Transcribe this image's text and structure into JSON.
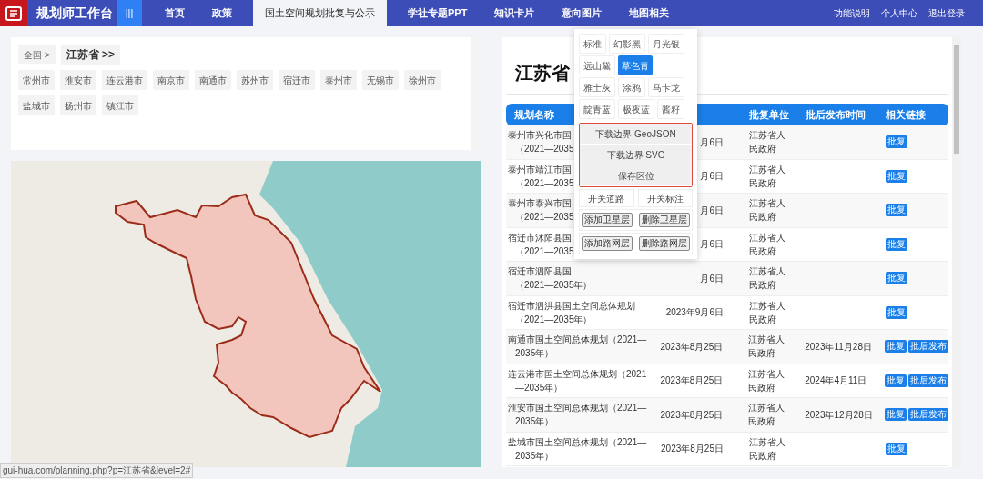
{
  "header": {
    "title": "规划师工作台",
    "menu_glyph": "|||",
    "nav": [
      {
        "label": "首页",
        "selected": false
      },
      {
        "label": "政策",
        "selected": false
      },
      {
        "label": "国土空间规划批复与公示",
        "selected": true
      },
      {
        "label": "学社专题PPT",
        "selected": false
      },
      {
        "label": "知识卡片",
        "selected": false
      },
      {
        "label": "意向图片",
        "selected": false
      },
      {
        "label": "地图相关",
        "selected": false
      }
    ],
    "user_links": [
      "功能说明",
      "个人中心",
      "退出登录"
    ]
  },
  "region_picker": {
    "breadcrumb": [
      {
        "label": "全国 >",
        "selected": false
      },
      {
        "label": "江苏省 >>",
        "selected": true
      }
    ],
    "cities": [
      "常州市",
      "淮安市",
      "连云港市",
      "南京市",
      "南通市",
      "苏州市",
      "宿迁市",
      "泰州市",
      "无锡市",
      "徐州市",
      "盐城市",
      "扬州市",
      "镇江市"
    ]
  },
  "status_url": "gui-hua.com/planning.php?p=江苏省&level=2#",
  "plans": {
    "title": "江苏省",
    "columns": [
      "规划名称",
      "批复单位",
      "批后发布时间",
      "相关链接"
    ],
    "rows": [
      {
        "name_lines": [
          "泰州市兴化市国",
          "（2021—2035"
        ],
        "date": "月6日",
        "unit": "江苏省人民政府",
        "links": [
          "批复"
        ]
      },
      {
        "name_lines": [
          "泰州市靖江市国",
          "（2021—2035"
        ],
        "date": "月6日",
        "unit": "江苏省人民政府",
        "links": [
          "批复"
        ]
      },
      {
        "name_lines": [
          "泰州市泰兴市国",
          "（2021—2035"
        ],
        "date": "月6日",
        "unit": "江苏省人民政府",
        "links": [
          "批复"
        ]
      },
      {
        "name_lines": [
          "宿迁市沭阳县国",
          "（2021—2035"
        ],
        "date": "月6日",
        "unit": "江苏省人民政府",
        "links": [
          "批复"
        ]
      },
      {
        "name_lines": [
          "宿迁市泗阳县国",
          "（2021—2035年）"
        ],
        "date": "月6日",
        "unit": "江苏省人民政府",
        "links": [
          "批复"
        ]
      },
      {
        "name_lines": [
          "宿迁市泗洪县国土空间总体规划",
          "（2021—2035年）"
        ],
        "date": "2023年9月6日",
        "unit": "江苏省人民政府",
        "links": [
          "批复"
        ]
      },
      {
        "name_lines": [
          "南通市国土空间总体规划（2021—",
          "2035年）"
        ],
        "date": "2023年8月25日",
        "unit": "江苏省人民政府",
        "published": "2023年11月28日",
        "links": [
          "批复",
          "批后发布"
        ]
      },
      {
        "name_lines": [
          "连云港市国土空间总体规划（2021",
          "—2035年）"
        ],
        "date": "2023年8月25日",
        "unit": "江苏省人民政府",
        "published": "2024年4月11日",
        "links": [
          "批复",
          "批后发布"
        ]
      },
      {
        "name_lines": [
          "淮安市国土空间总体规划（2021—",
          "2035年）"
        ],
        "date": "2023年8月25日",
        "unit": "江苏省人民政府",
        "published": "2023年12月28日",
        "links": [
          "批复",
          "批后发布"
        ]
      },
      {
        "name_lines": [
          "盐城市国土空间总体规划（2021—",
          "2035年）"
        ],
        "date": "2023年8月25日",
        "unit": "江苏省人民政府",
        "links": [
          "批复"
        ]
      }
    ]
  },
  "map_menu": {
    "styles": [
      [
        {
          "label": "标准",
          "selected": false
        },
        {
          "label": "幻影黑",
          "selected": false
        },
        {
          "label": "月光银",
          "selected": false
        }
      ],
      [
        {
          "label": "远山黛",
          "selected": false
        },
        {
          "label": "草色青",
          "selected": true
        }
      ],
      [
        {
          "label": "雅士灰",
          "selected": false
        },
        {
          "label": "涂鸦",
          "selected": false
        },
        {
          "label": "马卡龙",
          "selected": false
        }
      ],
      [
        {
          "label": "靛青蓝",
          "selected": false
        },
        {
          "label": "极夜蓝",
          "selected": false
        },
        {
          "label": "酱籽",
          "selected": false
        }
      ]
    ],
    "export_actions": [
      "下载边界 GeoJSON",
      "下载边界 SVG",
      "保存区位"
    ],
    "toggles": [
      "开关道路",
      "开关标注"
    ],
    "layer_buttons": [
      [
        "添加卫星层",
        "删除卫星层"
      ],
      [
        "添加路网层",
        "删除路网层"
      ]
    ]
  }
}
